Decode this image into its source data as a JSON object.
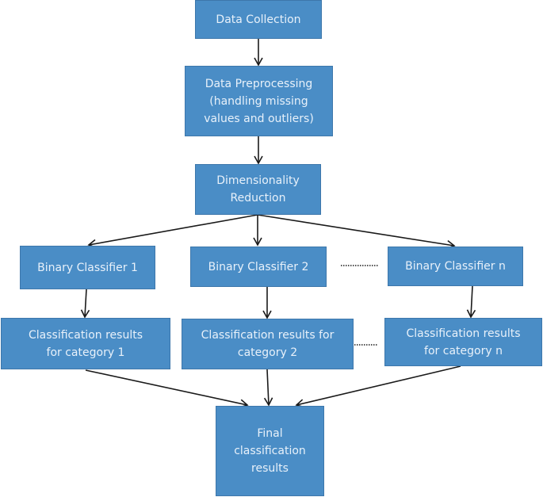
{
  "diagram": {
    "type": "flowchart",
    "colors": {
      "node_fill": "#4a8dc6",
      "node_border": "#3d77ab",
      "node_text": "#e8f1fa",
      "arrow": "#1a1a1a",
      "background": "#ffffff"
    },
    "nodes": {
      "data_collection": "Data Collection",
      "data_preprocessing": "Data Preprocessing\n(handling missing\nvalues and outliers)",
      "dimensionality_reduction": "Dimensionality\nReduction",
      "binary_classifier_1": "Binary Classifier 1",
      "binary_classifier_2": "Binary Classifier 2",
      "binary_classifier_n": "Binary Classifier n",
      "results_category_1": "Classification results\nfor category 1",
      "results_category_2": "Classification results for\ncategory 2",
      "results_category_n": "Classification results\nfor category n",
      "final_results": "Final\nclassification\nresults"
    },
    "edges": [
      {
        "from": "data_collection",
        "to": "data_preprocessing",
        "style": "arrow"
      },
      {
        "from": "data_preprocessing",
        "to": "dimensionality_reduction",
        "style": "arrow"
      },
      {
        "from": "dimensionality_reduction",
        "to": "binary_classifier_1",
        "style": "arrow"
      },
      {
        "from": "dimensionality_reduction",
        "to": "binary_classifier_2",
        "style": "arrow"
      },
      {
        "from": "dimensionality_reduction",
        "to": "binary_classifier_n",
        "style": "arrow"
      },
      {
        "from": "binary_classifier_1",
        "to": "results_category_1",
        "style": "arrow"
      },
      {
        "from": "binary_classifier_2",
        "to": "results_category_2",
        "style": "arrow"
      },
      {
        "from": "binary_classifier_n",
        "to": "results_category_n",
        "style": "arrow"
      },
      {
        "from": "results_category_1",
        "to": "final_results",
        "style": "arrow"
      },
      {
        "from": "results_category_2",
        "to": "final_results",
        "style": "arrow"
      },
      {
        "from": "results_category_n",
        "to": "final_results",
        "style": "arrow"
      },
      {
        "from": "binary_classifier_2",
        "to": "binary_classifier_n",
        "style": "dotted"
      },
      {
        "from": "results_category_2",
        "to": "results_category_n",
        "style": "dotted"
      }
    ]
  }
}
